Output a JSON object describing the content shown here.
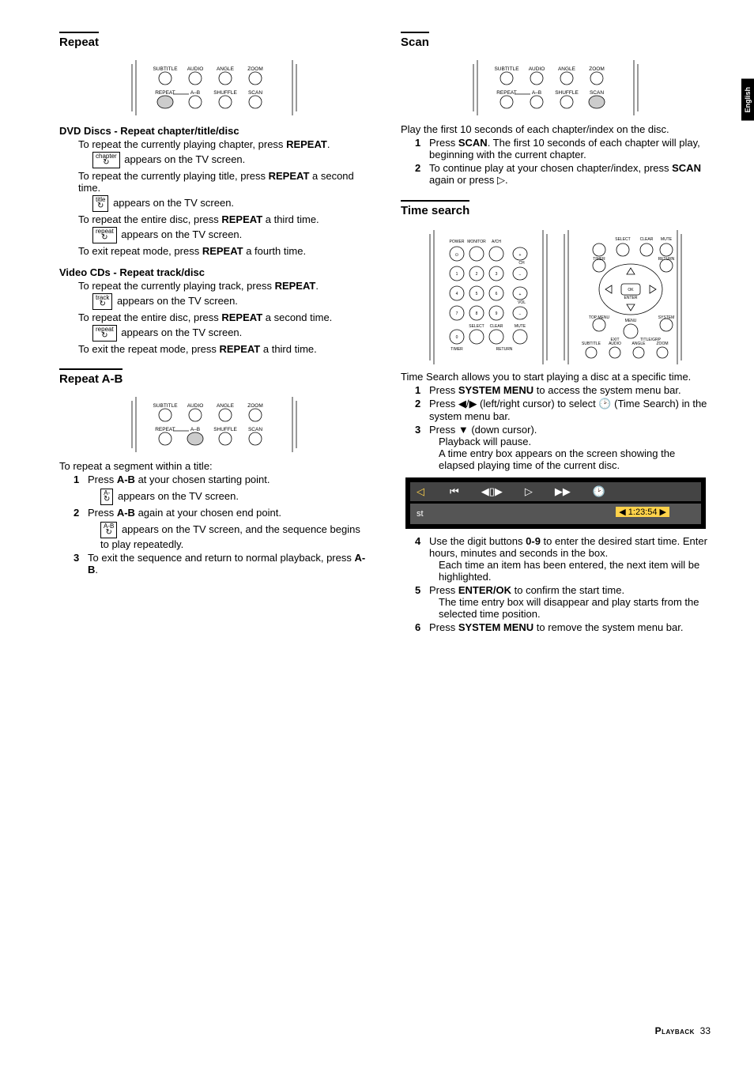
{
  "side_tab": "English",
  "remote_labels": {
    "top": [
      "SUBTITLE",
      "AUDIO",
      "ANGLE",
      "ZOOM"
    ],
    "bottom": [
      "REPEAT",
      "A–B",
      "SHUFFLE",
      "SCAN"
    ]
  },
  "left": {
    "repeat": {
      "title": "Repeat",
      "dvd": {
        "heading": "DVD Discs - Repeat chapter/title/disc",
        "l1a": "To repeat the currently playing chapter, press",
        "l1b": "REPEAT",
        "l1c": ".",
        "icon_chapter": "chapter",
        "l2": " appears on the TV screen.",
        "l3a": "To repeat the currently playing title, press ",
        "l3b": "REPEAT",
        "l3c": " a second time.",
        "icon_title": "title",
        "l4": " appears on the TV screen.",
        "l5a": "To repeat the entire disc, press ",
        "l5b": "REPEAT",
        "l5c": " a third time.",
        "icon_repeat1": "repeat",
        "l6": " appears on the TV screen.",
        "l7a": "To exit repeat mode, press ",
        "l7b": "REPEAT",
        "l7c": " a fourth time."
      },
      "vcd": {
        "heading": "Video CDs - Repeat track/disc",
        "l1a": "To repeat the currently playing track, press ",
        "l1b": "REPEAT",
        "l1c": ".",
        "icon_track": "track",
        "l2": " appears on the TV screen.",
        "l3a": "To repeat the entire disc, press ",
        "l3b": "REPEAT",
        "l3c": " a second time.",
        "icon_repeat2": "repeat",
        "l4": " appears on the TV screen.",
        "l5a": "To exit the repeat mode, press ",
        "l5b": "REPEAT",
        "l5c": " a third time."
      }
    },
    "repeat_ab": {
      "title": "Repeat A-B",
      "intro": "To repeat a segment within a title:",
      "s1a": "Press ",
      "s1b": "A-B",
      "s1c": " at your chosen starting point.",
      "icon_a": "A-",
      "s1d": " appears on the TV screen.",
      "s2a": "Press ",
      "s2b": "A-B",
      "s2c": " again at your chosen end point.",
      "icon_ab": "A-B",
      "s2d": " appears on the TV screen, and the sequence begins to play repeatedly.",
      "s3a": "To exit the sequence and return to normal playback, press ",
      "s3b": "A-B",
      "s3c": "."
    }
  },
  "right": {
    "scan": {
      "title": "Scan",
      "intro": "Play the first 10 seconds of each chapter/index on the disc.",
      "s1a": "Press ",
      "s1b": "SCAN",
      "s1c": ". The first 10 seconds of each chapter will play, beginning with the current chapter.",
      "s2a": "To continue play at your chosen chapter/index, press ",
      "s2b": "SCAN",
      "s2c": " again or press ▷."
    },
    "time": {
      "title": "Time search",
      "intro": "Time Search allows you to start playing a disc at a specific time.",
      "s1a": "Press ",
      "s1b": "SYSTEM MENU",
      "s1c": " to access the system menu bar.",
      "s2": "Press ◀/▶ (left/right cursor) to select 🕑  (Time Search) in the system menu bar.",
      "s3a": "Press ▼ (down cursor).",
      "s3b": "Playback will pause.",
      "s3c": "A time entry box appears on the screen showing the elapsed playing time of the current disc.",
      "osd": {
        "icons": [
          "⏮",
          "◀▯▶",
          "▷",
          "▶▶",
          "🕑"
        ],
        "st": "st",
        "time": "◀ 1:23:54 ▶"
      },
      "s4a": "Use the digit buttons ",
      "s4b": "0-9",
      "s4c": " to enter the desired start time. Enter hours, minutes and seconds in the box.",
      "s4d": "Each time an item has been entered, the next item will be highlighted.",
      "s5a": "Press ",
      "s5b": "ENTER/OK",
      "s5c": " to confirm the start time.",
      "s5d": "The time entry box will disappear and play starts from the selected time position.",
      "s6a": "Press ",
      "s6b": "SYSTEM MENU",
      "s6c": " to remove the system menu bar."
    }
  },
  "footer": {
    "label": "Playback",
    "page": "33"
  }
}
